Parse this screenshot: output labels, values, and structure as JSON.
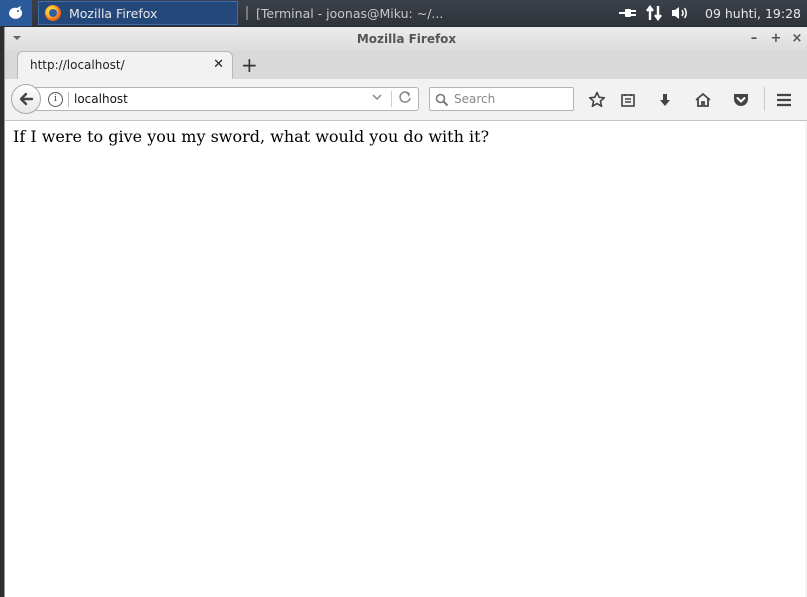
{
  "taskbar": {
    "tasks": [
      {
        "label": "Mozilla Firefox",
        "icon": "firefox-icon",
        "active": true
      },
      {
        "label": "[Terminal - joonas@Miku: ~/...",
        "icon": "terminal-icon",
        "active": false
      }
    ],
    "tray_icons": [
      "power-plug-icon",
      "network-icon",
      "volume-icon"
    ],
    "clock": "09 huhti, 19:28"
  },
  "window": {
    "title": "Mozilla Firefox",
    "controls": [
      "minimize",
      "maximize",
      "close"
    ]
  },
  "tabs": [
    {
      "label": "http://localhost/"
    }
  ],
  "navbar": {
    "url": "localhost",
    "search_placeholder": "Search",
    "icons": [
      "back-icon",
      "info-icon",
      "dropdown-icon",
      "reload-icon",
      "search-icon",
      "bookmark-star-icon",
      "reading-list-icon",
      "downloads-icon",
      "home-icon",
      "pocket-icon",
      "menu-icon"
    ]
  },
  "page": {
    "text": "If I were to give you my sword, what would you do with it?"
  },
  "colors": {
    "taskbar_bg": "#2f333a",
    "active_task_bg": "#25487a",
    "window_chrome": "#f2f2f2",
    "content_bg": "#ffffff"
  }
}
